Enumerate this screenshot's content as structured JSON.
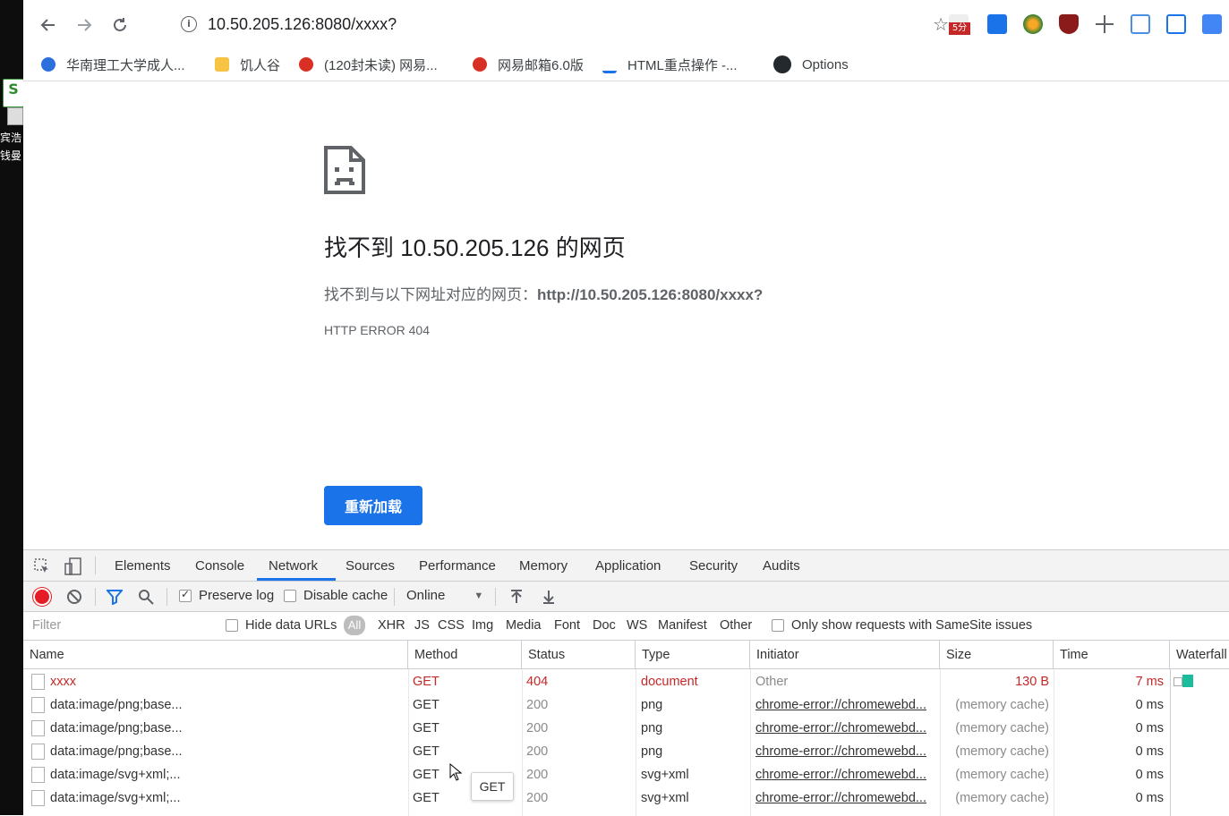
{
  "desktop": {
    "caption1": "宾浩",
    "caption2": "钱曼"
  },
  "browser": {
    "url": "10.50.205.126:8080/xxxx?",
    "ext_badge": "5分",
    "bookmarks": [
      {
        "label": "华南理工大学成人...",
        "color": "#2a6fdb"
      },
      {
        "label": "饥人谷",
        "color": "#f6c344"
      },
      {
        "label": "(120封未读) 网易...",
        "color": "#d93025"
      },
      {
        "label": "网易邮箱6.0版",
        "color": "#d93025"
      },
      {
        "label": "HTML重点操作 -...",
        "color": "#1a73e8"
      },
      {
        "label": "Options",
        "color": "#24292e"
      }
    ]
  },
  "page": {
    "title": "找不到 10.50.205.126 的网页",
    "desc_prefix": "找不到与以下网址对应的网页：",
    "desc_url": "http://10.50.205.126:8080/xxxx?",
    "code": "HTTP ERROR 404",
    "reload": "重新加载"
  },
  "devtools": {
    "tabs": [
      "Elements",
      "Console",
      "Network",
      "Sources",
      "Performance",
      "Memory",
      "Application",
      "Security",
      "Audits"
    ],
    "active_tab": "Network",
    "preserve_log": "Preserve log",
    "disable_cache": "Disable cache",
    "throttle": "Online",
    "filter_placeholder": "Filter",
    "hide_data_urls": "Hide data URLs",
    "all": "All",
    "types": [
      "XHR",
      "JS",
      "CSS",
      "Img",
      "Media",
      "Font",
      "Doc",
      "WS",
      "Manifest",
      "Other"
    ],
    "samesite": "Only show requests with SameSite issues",
    "columns": [
      "Name",
      "Method",
      "Status",
      "Type",
      "Initiator",
      "Size",
      "Time",
      "Waterfall"
    ],
    "rows": [
      {
        "name": "xxxx",
        "method": "GET",
        "status": "404",
        "type": "document",
        "initiator": "Other",
        "size": "130 B",
        "time": "7 ms",
        "error": true
      },
      {
        "name": "data:image/png;base...",
        "method": "GET",
        "status": "200",
        "type": "png",
        "initiator": "chrome-error://chromewebd...",
        "size": "(memory cache)",
        "time": "0 ms",
        "error": false
      },
      {
        "name": "data:image/png;base...",
        "method": "GET",
        "status": "200",
        "type": "png",
        "initiator": "chrome-error://chromewebd...",
        "size": "(memory cache)",
        "time": "0 ms",
        "error": false
      },
      {
        "name": "data:image/png;base...",
        "method": "GET",
        "status": "200",
        "type": "png",
        "initiator": "chrome-error://chromewebd...",
        "size": "(memory cache)",
        "time": "0 ms",
        "error": false
      },
      {
        "name": "data:image/svg+xml;...",
        "method": "GET",
        "status": "200",
        "type": "svg+xml",
        "initiator": "chrome-error://chromewebd...",
        "size": "(memory cache)",
        "time": "0 ms",
        "error": false
      },
      {
        "name": "data:image/svg+xml;...",
        "method": "GET",
        "status": "200",
        "type": "svg+xml",
        "initiator": "chrome-error://chromewebd...",
        "size": "(memory cache)",
        "time": "0 ms",
        "error": false
      }
    ],
    "tooltip": "GET"
  }
}
